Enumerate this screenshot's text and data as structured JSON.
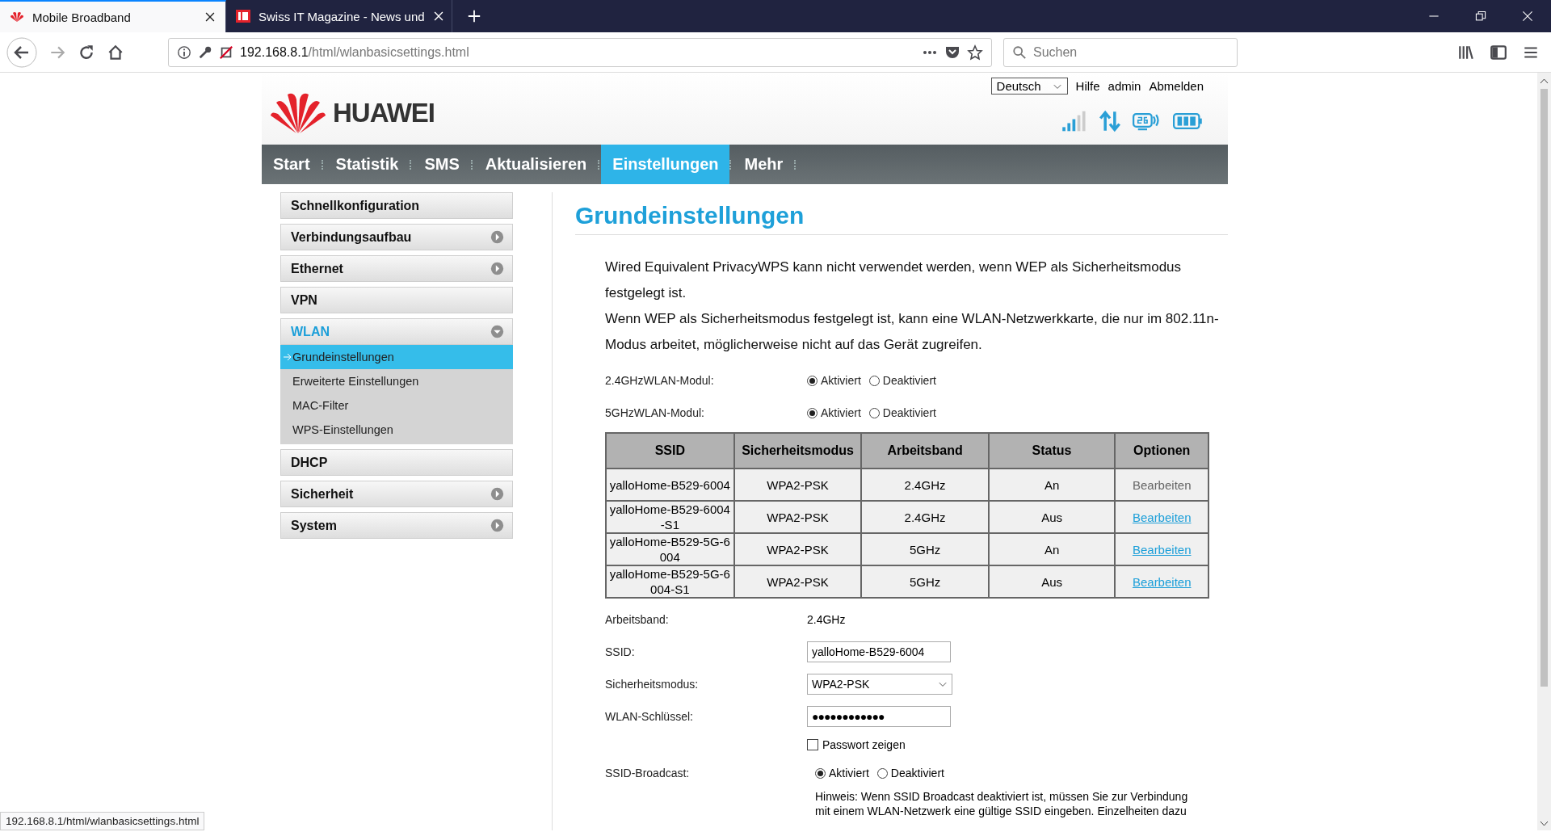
{
  "browser": {
    "tabs": [
      {
        "title": "Mobile Broadband",
        "selected": true
      },
      {
        "title": "Swiss IT Magazine - News und",
        "selected": false
      }
    ],
    "url_host": "192.168.8.1",
    "url_path": "/html/wlanbasicsettings.html",
    "search_placeholder": "Suchen"
  },
  "header": {
    "logo": "HUAWEI",
    "language": "Deutsch",
    "links": [
      "Hilfe",
      "admin",
      "Abmelden"
    ]
  },
  "nav": [
    {
      "label": "Start",
      "selected": false
    },
    {
      "label": "Statistik",
      "selected": false
    },
    {
      "label": "SMS",
      "selected": false
    },
    {
      "label": "Aktualisieren",
      "selected": false
    },
    {
      "label": "Einstellungen",
      "selected": true
    },
    {
      "label": "Mehr",
      "selected": false
    }
  ],
  "sidebar": [
    {
      "label": "Schnellkonfiguration",
      "kind": "plain",
      "expanded": false
    },
    {
      "label": "Verbindungsaufbau",
      "kind": "submenu",
      "expanded": false
    },
    {
      "label": "Ethernet",
      "kind": "submenu",
      "expanded": false
    },
    {
      "label": "VPN",
      "kind": "plain",
      "expanded": false
    },
    {
      "label": "WLAN",
      "kind": "submenu",
      "expanded": true,
      "children": [
        {
          "label": "Grundeinstellungen",
          "selected": true
        },
        {
          "label": "Erweiterte Einstellungen",
          "selected": false
        },
        {
          "label": "MAC-Filter",
          "selected": false
        },
        {
          "label": "WPS-Einstellungen",
          "selected": false
        }
      ]
    },
    {
      "label": "DHCP",
      "kind": "plain",
      "expanded": false
    },
    {
      "label": "Sicherheit",
      "kind": "submenu",
      "expanded": false
    },
    {
      "label": "System",
      "kind": "submenu",
      "expanded": false
    }
  ],
  "content": {
    "title": "Grundeinstellungen",
    "notes": [
      "Wired Equivalent PrivacyWPS kann nicht verwendet werden, wenn WEP als Sicherheitsmodus festgelegt ist.",
      "Wenn WEP als Sicherheitsmodus festgelegt ist, kann eine WLAN-Netzwerkkarte, die nur im 802.11n-Modus arbeitet, möglicherweise nicht auf das Gerät zugreifen."
    ],
    "modules": [
      {
        "label": "2.4GHzWLAN-Modul:",
        "options": [
          {
            "label": "Aktiviert",
            "selected": true
          },
          {
            "label": "Deaktiviert",
            "selected": false
          }
        ]
      },
      {
        "label": "5GHzWLAN-Modul:",
        "options": [
          {
            "label": "Aktiviert",
            "selected": true
          },
          {
            "label": "Deaktiviert",
            "selected": false
          }
        ]
      }
    ],
    "table": {
      "columns": [
        "SSID",
        "Sicherheitsmodus",
        "Arbeitsband",
        "Status",
        "Optionen"
      ],
      "rows": [
        {
          "cells": [
            "yalloHome-B529-6004",
            "WPA2-PSK",
            "2.4GHz",
            "An"
          ],
          "action": "Bearbeiten",
          "disabled": true
        },
        {
          "cells": [
            "yalloHome-B529-6004-S1",
            "WPA2-PSK",
            "2.4GHz",
            "Aus"
          ],
          "action": "Bearbeiten",
          "disabled": false
        },
        {
          "cells": [
            "yalloHome-B529-5G-6004",
            "WPA2-PSK",
            "5GHz",
            "An"
          ],
          "action": "Bearbeiten",
          "disabled": false
        },
        {
          "cells": [
            "yalloHome-B529-5G-6004-S1",
            "WPA2-PSK",
            "5GHz",
            "Aus"
          ],
          "action": "Bearbeiten",
          "disabled": false
        }
      ]
    },
    "form": {
      "band": {
        "label": "Arbeitsband:",
        "value": "2.4GHz"
      },
      "ssid": {
        "label": "SSID:",
        "value": "yalloHome-B529-6004"
      },
      "security": {
        "label": "Sicherheitsmodus:",
        "value": "WPA2-PSK"
      },
      "key": {
        "label": "WLAN-Schlüssel:",
        "value": "●●●●●●●●●●●●"
      },
      "show_password": {
        "label": "Passwort zeigen",
        "checked": false
      },
      "broadcast": {
        "label": "SSID-Broadcast:",
        "options": [
          {
            "label": "Aktiviert",
            "selected": true
          },
          {
            "label": "Deaktiviert",
            "selected": false
          }
        ]
      },
      "hint": [
        "Hinweis: Wenn SSID Broadcast deaktiviert ist, müssen Sie zur Verbindung",
        "mit einem WLAN-Netzwerk eine gültige SSID eingeben. Einzelheiten dazu"
      ]
    }
  },
  "status_bar": "192.168.8.1/html/wlanbasicsettings.html"
}
